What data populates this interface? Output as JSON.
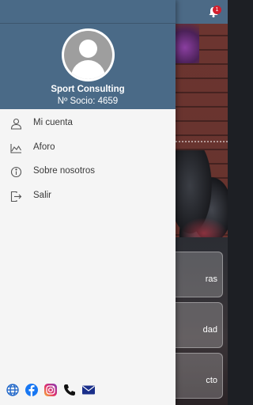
{
  "app": {
    "notification_count": "1",
    "cards": [
      {
        "label": "ras"
      },
      {
        "label": "dad"
      },
      {
        "label": "cto"
      }
    ]
  },
  "drawer": {
    "user": {
      "name": "Sport Consulting",
      "member_number": "Nº Socio: 4659"
    },
    "menu": [
      {
        "label": "Mi cuenta",
        "icon": "person-icon"
      },
      {
        "label": "Aforo",
        "icon": "chart-icon"
      },
      {
        "label": "Sobre nosotros",
        "icon": "info-icon"
      },
      {
        "label": "Salir",
        "icon": "logout-icon"
      }
    ],
    "social": [
      "globe-icon",
      "facebook-icon",
      "instagram-icon",
      "phone-icon",
      "mail-icon"
    ]
  },
  "colors": {
    "header": "#4a6a87",
    "badge": "#d2202f",
    "facebook": "#1877f2",
    "mail": "#1a2f8a",
    "globe": "#1b63c8"
  }
}
